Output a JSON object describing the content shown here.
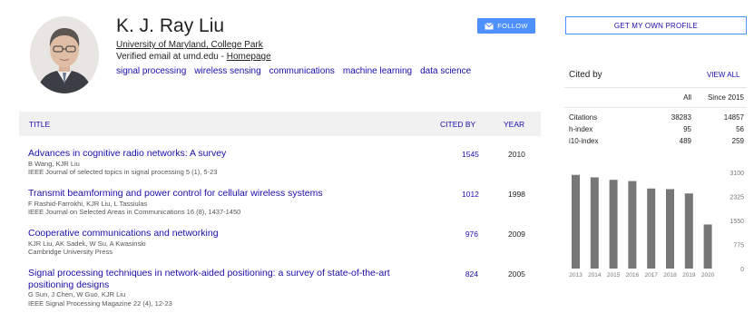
{
  "profile": {
    "name": "K. J. Ray Liu",
    "affiliation": "University of Maryland, College Park",
    "verified_prefix": "Verified email at umd.edu - ",
    "homepage_label": "Homepage",
    "interests": [
      "signal processing",
      "wireless sensing",
      "communications",
      "machine learning",
      "data science"
    ],
    "follow_label": "FOLLOW"
  },
  "table": {
    "headers": {
      "title": "TITLE",
      "cited_by": "CITED BY",
      "year": "YEAR"
    },
    "articles": [
      {
        "title": "Advances in cognitive radio networks: A survey",
        "authors": "B Wang, KJR Liu",
        "venue": "IEEE Journal of selected topics in signal processing 5 (1), 5-23",
        "cited_by": "1545",
        "year": "2010"
      },
      {
        "title": "Transmit beamforming and power control for cellular wireless systems",
        "authors": "F Rashid-Farrokhi, KJR Liu, L Tassiulas",
        "venue": "IEEE Journal on Selected Areas in Communications 16 (8), 1437-1450",
        "cited_by": "1012",
        "year": "1998"
      },
      {
        "title": "Cooperative communications and networking",
        "authors": "KJR Liu, AK Sadek, W Su, A Kwasinski",
        "venue": "Cambridge University Press",
        "cited_by": "976",
        "year": "2009"
      },
      {
        "title": "Signal processing techniques in network-aided positioning: a survey of state-of-the-art positioning designs",
        "authors": "G Sun, J Chen, W Guo, KJR Liu",
        "venue": "IEEE Signal Processing Magazine 22 (4), 12-23",
        "cited_by": "824",
        "year": "2005"
      }
    ]
  },
  "sidebar": {
    "get_profile_label": "GET MY OWN PROFILE",
    "cited_by_title": "Cited by",
    "view_all_label": "VIEW ALL",
    "col_all": "All",
    "col_since": "Since 2015",
    "stats": [
      {
        "label": "Citations",
        "all": "38283",
        "since": "14857"
      },
      {
        "label": "h-index",
        "all": "95",
        "since": "56"
      },
      {
        "label": "i10-index",
        "all": "489",
        "since": "259"
      }
    ]
  },
  "chart_data": {
    "type": "bar",
    "categories": [
      "2013",
      "2014",
      "2015",
      "2016",
      "2017",
      "2018",
      "2019",
      "2020"
    ],
    "values": [
      3020,
      2940,
      2860,
      2820,
      2580,
      2560,
      2420,
      1420
    ],
    "ylim": [
      0,
      3100
    ],
    "yticks": [
      0,
      775,
      1550,
      2325,
      3100
    ],
    "y_axis_side": "right",
    "bar_color": "#777777",
    "grid": false
  },
  "colors": {
    "link": "#1a0dab",
    "accent": "#4d90fe",
    "header_bg": "#f1f1f1"
  },
  "icons": {
    "follow": "envelope-icon"
  }
}
